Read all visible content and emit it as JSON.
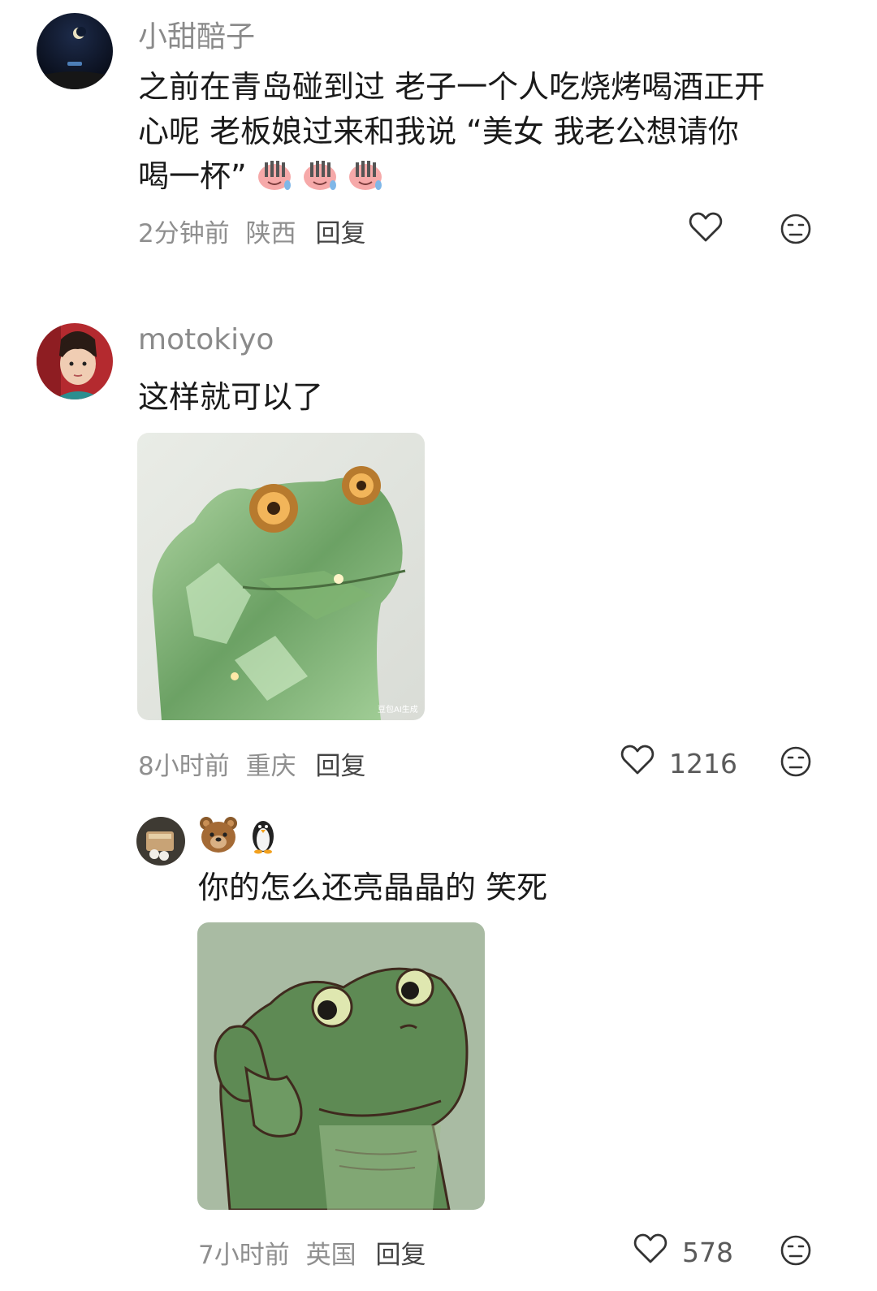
{
  "comments": [
    {
      "username": "小甜醅子",
      "text_lines": [
        "之前在青岛碰到过 老子一个人吃烧烤喝酒正开",
        "心呢 老板娘过来和我说 “美女 我老公想请你",
        "喝一杯”"
      ],
      "time": "2分钟前",
      "location": "陕西",
      "reply": "回复",
      "likes": "",
      "inline_emojis": [
        "sweat-laugh-emoji",
        "sweat-laugh-emoji",
        "sweat-laugh-emoji"
      ]
    },
    {
      "username": "motokiyo",
      "text": "这样就可以了",
      "image": "crystal-frog-thinking",
      "watermark": "豆包AI生成",
      "time": "8小时前",
      "location": "重庆",
      "reply": "回复",
      "likes": "1216"
    },
    {
      "username_emojis": [
        "bear-emoji",
        "penguin-emoji"
      ],
      "text": "你的怎么还亮晶晶的 笑死",
      "image": "cartoon-frog-thinking",
      "time": "7小时前",
      "location": "英国",
      "reply": "回复",
      "likes": "578"
    }
  ],
  "icons": {
    "like": "heart-outline-icon",
    "dislike": "neutral-face-icon"
  }
}
